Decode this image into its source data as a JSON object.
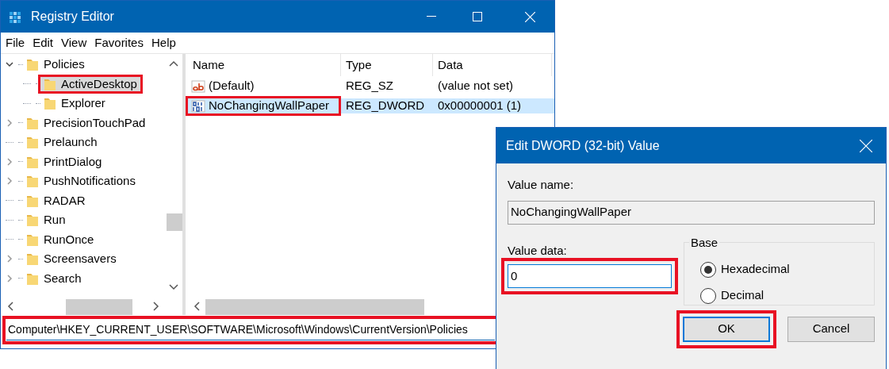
{
  "registry_editor": {
    "title": "Registry Editor",
    "menu": [
      "File",
      "Edit",
      "View",
      "Favorites",
      "Help"
    ],
    "tree": [
      {
        "label": "Policies",
        "kind": "branch",
        "expanded": true,
        "selected": false,
        "highlighted": false,
        "children": [
          {
            "label": "ActiveDesktop",
            "kind": "leaf",
            "selected": true,
            "highlighted": true
          },
          {
            "label": "Explorer",
            "kind": "leaf",
            "selected": false,
            "highlighted": false
          }
        ]
      },
      {
        "label": "PrecisionTouchPad",
        "kind": "branch",
        "expanded": false,
        "selected": false,
        "highlighted": false
      },
      {
        "label": "Prelaunch",
        "kind": "leaf",
        "selected": false,
        "highlighted": false
      },
      {
        "label": "PrintDialog",
        "kind": "branch",
        "expanded": false,
        "selected": false,
        "highlighted": false
      },
      {
        "label": "PushNotifications",
        "kind": "branch",
        "expanded": false,
        "selected": false,
        "highlighted": false
      },
      {
        "label": "RADAR",
        "kind": "leaf",
        "selected": false,
        "highlighted": false
      },
      {
        "label": "Run",
        "kind": "leaf",
        "selected": false,
        "highlighted": false
      },
      {
        "label": "RunOnce",
        "kind": "leaf",
        "selected": false,
        "highlighted": false
      },
      {
        "label": "Screensavers",
        "kind": "branch",
        "expanded": false,
        "selected": false,
        "highlighted": false
      },
      {
        "label": "Search",
        "kind": "branch",
        "expanded": false,
        "selected": false,
        "highlighted": false
      }
    ],
    "values": {
      "columns": [
        "Name",
        "Type",
        "Data"
      ],
      "rows": [
        {
          "kind": "string",
          "name": "(Default)",
          "type": "REG_SZ",
          "data": "(value not set)",
          "selected": false,
          "highlighted": false
        },
        {
          "kind": "number",
          "name": "NoChangingWallPaper",
          "type": "REG_DWORD",
          "data": "0x00000001 (1)",
          "selected": true,
          "highlighted": true
        }
      ]
    },
    "address": {
      "value": "Computer\\HKEY_CURRENT_USER\\SOFTWARE\\Microsoft\\Windows\\CurrentVersion\\Policies",
      "highlighted": true
    }
  },
  "dialog": {
    "title": "Edit DWORD (32-bit) Value",
    "value_name_label": "Value name:",
    "value_name": "NoChangingWallPaper",
    "value_data_label": "Value data:",
    "value_data": {
      "value": "0",
      "highlighted": true
    },
    "base": {
      "label": "Base",
      "options": [
        {
          "label": "Hexadecimal",
          "selected": true
        },
        {
          "label": "Decimal",
          "selected": false
        }
      ]
    },
    "buttons": [
      {
        "label": "OK",
        "default": true,
        "highlighted": true
      },
      {
        "label": "Cancel",
        "default": false,
        "highlighted": false
      }
    ]
  }
}
